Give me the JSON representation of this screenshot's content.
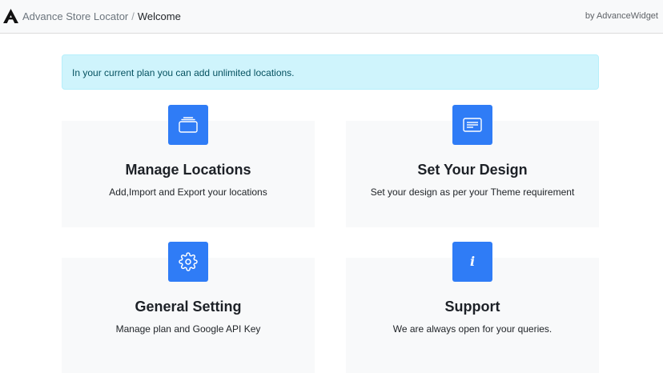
{
  "header": {
    "app_name": "Advance Store Locator",
    "separator": "/",
    "page_title": "Welcome",
    "byline": "by AdvanceWidget",
    "logo_icon": "advance-logo-icon"
  },
  "alert": {
    "text": "In your current plan you can add unlimited locations."
  },
  "cards": [
    {
      "title": "Manage Locations",
      "description": "Add,Import and Export your locations",
      "icon": "folder-icon"
    },
    {
      "title": "Set Your Design",
      "description": "Set your design as per your Theme requirement",
      "icon": "layout-card-icon"
    },
    {
      "title": "General Setting",
      "description": "Manage plan and Google API Key",
      "icon": "gear-icon"
    },
    {
      "title": "Support",
      "description": "We are always open for your queries.",
      "icon": "info-icon",
      "icon_glyph": "i"
    }
  ],
  "colors": {
    "accent": "#2f7cf6",
    "alert_bg": "#cff4fc",
    "card_bg": "#f8f9fa"
  }
}
